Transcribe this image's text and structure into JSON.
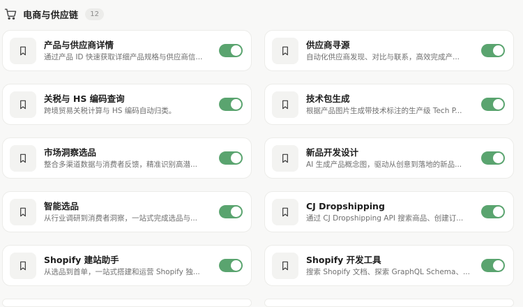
{
  "section": {
    "title": "电商与供应链",
    "count": "12",
    "icon": "shopping-cart-icon"
  },
  "colors": {
    "toggle_on": "#5aa46f",
    "card_bg": "#ffffff",
    "page_bg": "#f8f8f7"
  },
  "cards": [
    {
      "title": "产品与供应商详情",
      "desc": "通过产品 ID 快速获取详细产品规格与供应商信...",
      "icon": "bookmark-icon",
      "enabled": true
    },
    {
      "title": "供应商寻源",
      "desc": "自动化供应商发现、对比与联系，高效完成产...",
      "icon": "bookmark-icon",
      "enabled": true
    },
    {
      "title": "关税与 HS 编码查询",
      "desc": "跨境贸易关税计算与 HS 编码自动归类。",
      "icon": "bookmark-icon",
      "enabled": true
    },
    {
      "title": "技术包生成",
      "desc": "根据产品图片生成带技术标注的生产级 Tech P...",
      "icon": "bookmark-icon",
      "enabled": true
    },
    {
      "title": "市场洞察选品",
      "desc": "整合多渠道数据与消费者反馈，精准识别高潜...",
      "icon": "bookmark-icon",
      "enabled": true
    },
    {
      "title": "新品开发设计",
      "desc": "AI 生成产品概念图，驱动从创意到落地的新品...",
      "icon": "bookmark-icon",
      "enabled": true
    },
    {
      "title": "智能选品",
      "desc": "从行业调研到消费者洞察，一站式完成选品与...",
      "icon": "bookmark-icon",
      "enabled": true
    },
    {
      "title": "CJ Dropshipping",
      "desc": "通过 CJ Dropshipping API 搜索商品、创建订...",
      "icon": "bookmark-icon",
      "enabled": true
    },
    {
      "title": "Shopify 建站助手",
      "desc": "从选品到首单，一站式搭建和运营 Shopify 独...",
      "icon": "bookmark-icon",
      "enabled": true
    },
    {
      "title": "Shopify 开发工具",
      "desc": "搜索 Shopify 文档、探索 GraphQL Schema、...",
      "icon": "bookmark-icon",
      "enabled": true
    }
  ]
}
